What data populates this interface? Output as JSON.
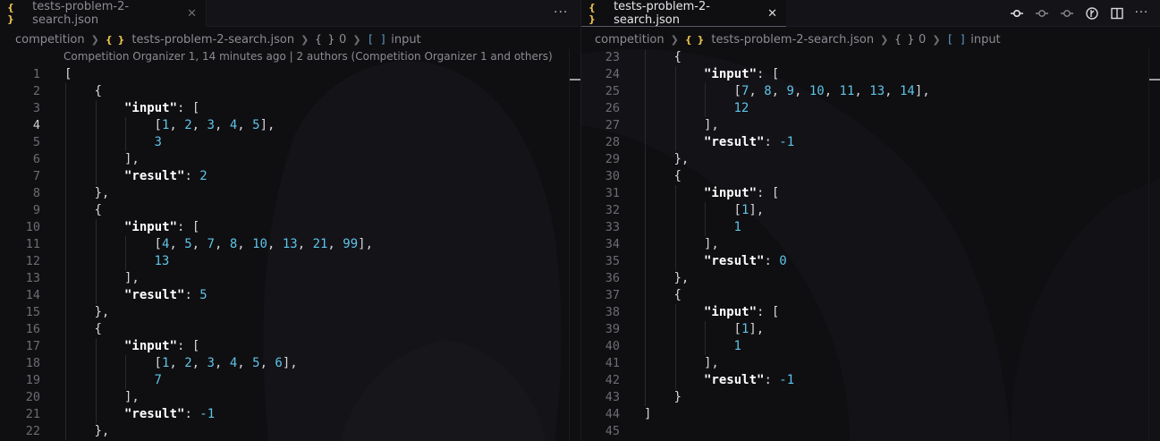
{
  "left_pane": {
    "tab": {
      "icon": "{ }",
      "label": "tests-problem-2-search.json",
      "close": "✕"
    },
    "more": "···",
    "breadcrumb": {
      "folder": "competition",
      "file_icon": "{ }",
      "file": "tests-problem-2-search.json",
      "obj_icon": "{ }",
      "obj": "0",
      "arr_icon": "[ ]",
      "field": "input"
    },
    "blame": "Competition Organizer 1, 14 minutes ago | 2 authors (Competition Organizer 1 and others)",
    "active_line": 4,
    "lines": [
      {
        "n": "1",
        "indent": 0,
        "t": [
          [
            "p",
            "["
          ]
        ]
      },
      {
        "n": "2",
        "indent": 1,
        "t": [
          [
            "p",
            "{"
          ]
        ]
      },
      {
        "n": "3",
        "indent": 2,
        "t": [
          [
            "k",
            "\"input\""
          ],
          [
            "p",
            ": ["
          ]
        ]
      },
      {
        "n": "4",
        "indent": 3,
        "t": [
          [
            "p",
            "["
          ],
          [
            "n",
            "1"
          ],
          [
            "p",
            ", "
          ],
          [
            "n",
            "2"
          ],
          [
            "p",
            ", "
          ],
          [
            "n",
            "3"
          ],
          [
            "p",
            ", "
          ],
          [
            "n",
            "4"
          ],
          [
            "p",
            ", "
          ],
          [
            "n",
            "5"
          ],
          [
            "p",
            "],"
          ]
        ]
      },
      {
        "n": "5",
        "indent": 3,
        "t": [
          [
            "n",
            "3"
          ]
        ]
      },
      {
        "n": "6",
        "indent": 2,
        "t": [
          [
            "p",
            "],"
          ]
        ]
      },
      {
        "n": "7",
        "indent": 2,
        "t": [
          [
            "k",
            "\"result\""
          ],
          [
            "p",
            ": "
          ],
          [
            "n",
            "2"
          ]
        ]
      },
      {
        "n": "8",
        "indent": 1,
        "t": [
          [
            "p",
            "},"
          ]
        ]
      },
      {
        "n": "9",
        "indent": 1,
        "t": [
          [
            "p",
            "{"
          ]
        ]
      },
      {
        "n": "10",
        "indent": 2,
        "t": [
          [
            "k",
            "\"input\""
          ],
          [
            "p",
            ": ["
          ]
        ]
      },
      {
        "n": "11",
        "indent": 3,
        "t": [
          [
            "p",
            "["
          ],
          [
            "n",
            "4"
          ],
          [
            "p",
            ", "
          ],
          [
            "n",
            "5"
          ],
          [
            "p",
            ", "
          ],
          [
            "n",
            "7"
          ],
          [
            "p",
            ", "
          ],
          [
            "n",
            "8"
          ],
          [
            "p",
            ", "
          ],
          [
            "n",
            "10"
          ],
          [
            "p",
            ", "
          ],
          [
            "n",
            "13"
          ],
          [
            "p",
            ", "
          ],
          [
            "n",
            "21"
          ],
          [
            "p",
            ", "
          ],
          [
            "n",
            "99"
          ],
          [
            "p",
            "],"
          ]
        ]
      },
      {
        "n": "12",
        "indent": 3,
        "t": [
          [
            "n",
            "13"
          ]
        ]
      },
      {
        "n": "13",
        "indent": 2,
        "t": [
          [
            "p",
            "],"
          ]
        ]
      },
      {
        "n": "14",
        "indent": 2,
        "t": [
          [
            "k",
            "\"result\""
          ],
          [
            "p",
            ": "
          ],
          [
            "n",
            "5"
          ]
        ]
      },
      {
        "n": "15",
        "indent": 1,
        "t": [
          [
            "p",
            "},"
          ]
        ]
      },
      {
        "n": "16",
        "indent": 1,
        "t": [
          [
            "p",
            "{"
          ]
        ]
      },
      {
        "n": "17",
        "indent": 2,
        "t": [
          [
            "k",
            "\"input\""
          ],
          [
            "p",
            ": ["
          ]
        ]
      },
      {
        "n": "18",
        "indent": 3,
        "t": [
          [
            "p",
            "["
          ],
          [
            "n",
            "1"
          ],
          [
            "p",
            ", "
          ],
          [
            "n",
            "2"
          ],
          [
            "p",
            ", "
          ],
          [
            "n",
            "3"
          ],
          [
            "p",
            ", "
          ],
          [
            "n",
            "4"
          ],
          [
            "p",
            ", "
          ],
          [
            "n",
            "5"
          ],
          [
            "p",
            ", "
          ],
          [
            "n",
            "6"
          ],
          [
            "p",
            "],"
          ]
        ]
      },
      {
        "n": "19",
        "indent": 3,
        "t": [
          [
            "n",
            "7"
          ]
        ]
      },
      {
        "n": "20",
        "indent": 2,
        "t": [
          [
            "p",
            "],"
          ]
        ]
      },
      {
        "n": "21",
        "indent": 2,
        "t": [
          [
            "k",
            "\"result\""
          ],
          [
            "p",
            ": "
          ],
          [
            "n",
            "-1"
          ]
        ]
      },
      {
        "n": "22",
        "indent": 1,
        "t": [
          [
            "p",
            "},"
          ]
        ]
      }
    ]
  },
  "right_pane": {
    "tab": {
      "icon": "{ }",
      "label": "tests-problem-2-search.json",
      "close": "✕"
    },
    "more": "···",
    "actions": [
      "git-compare-icon",
      "git-commit-prev-icon",
      "git-commit-next-icon",
      "timeline-icon",
      "split-editor-icon",
      "more-actions-icon"
    ],
    "breadcrumb": {
      "folder": "competition",
      "file_icon": "{ }",
      "file": "tests-problem-2-search.json",
      "obj_icon": "{ }",
      "obj": "0",
      "arr_icon": "[ ]",
      "field": "input"
    },
    "lines": [
      {
        "n": "23",
        "indent": 1,
        "t": [
          [
            "p",
            "{"
          ]
        ]
      },
      {
        "n": "24",
        "indent": 2,
        "t": [
          [
            "k",
            "\"input\""
          ],
          [
            "p",
            ": ["
          ]
        ]
      },
      {
        "n": "25",
        "indent": 3,
        "t": [
          [
            "p",
            "["
          ],
          [
            "n",
            "7"
          ],
          [
            "p",
            ", "
          ],
          [
            "n",
            "8"
          ],
          [
            "p",
            ", "
          ],
          [
            "n",
            "9"
          ],
          [
            "p",
            ", "
          ],
          [
            "n",
            "10"
          ],
          [
            "p",
            ", "
          ],
          [
            "n",
            "11"
          ],
          [
            "p",
            ", "
          ],
          [
            "n",
            "13"
          ],
          [
            "p",
            ", "
          ],
          [
            "n",
            "14"
          ],
          [
            "p",
            "],"
          ]
        ]
      },
      {
        "n": "26",
        "indent": 3,
        "t": [
          [
            "n",
            "12"
          ]
        ]
      },
      {
        "n": "27",
        "indent": 2,
        "t": [
          [
            "p",
            "],"
          ]
        ]
      },
      {
        "n": "28",
        "indent": 2,
        "t": [
          [
            "k",
            "\"result\""
          ],
          [
            "p",
            ": "
          ],
          [
            "n",
            "-1"
          ]
        ]
      },
      {
        "n": "29",
        "indent": 1,
        "t": [
          [
            "p",
            "},"
          ]
        ]
      },
      {
        "n": "30",
        "indent": 1,
        "t": [
          [
            "p",
            "{"
          ]
        ]
      },
      {
        "n": "31",
        "indent": 2,
        "t": [
          [
            "k",
            "\"input\""
          ],
          [
            "p",
            ": ["
          ]
        ]
      },
      {
        "n": "32",
        "indent": 3,
        "t": [
          [
            "p",
            "["
          ],
          [
            "n",
            "1"
          ],
          [
            "p",
            "],"
          ]
        ]
      },
      {
        "n": "33",
        "indent": 3,
        "t": [
          [
            "n",
            "1"
          ]
        ]
      },
      {
        "n": "34",
        "indent": 2,
        "t": [
          [
            "p",
            "],"
          ]
        ]
      },
      {
        "n": "35",
        "indent": 2,
        "t": [
          [
            "k",
            "\"result\""
          ],
          [
            "p",
            ": "
          ],
          [
            "n",
            "0"
          ]
        ]
      },
      {
        "n": "36",
        "indent": 1,
        "t": [
          [
            "p",
            "},"
          ]
        ]
      },
      {
        "n": "37",
        "indent": 1,
        "t": [
          [
            "p",
            "{"
          ]
        ]
      },
      {
        "n": "38",
        "indent": 2,
        "t": [
          [
            "k",
            "\"input\""
          ],
          [
            "p",
            ": ["
          ]
        ]
      },
      {
        "n": "39",
        "indent": 3,
        "t": [
          [
            "p",
            "["
          ],
          [
            "n",
            "1"
          ],
          [
            "p",
            "],"
          ]
        ]
      },
      {
        "n": "40",
        "indent": 3,
        "t": [
          [
            "n",
            "1"
          ]
        ]
      },
      {
        "n": "41",
        "indent": 2,
        "t": [
          [
            "p",
            "],"
          ]
        ]
      },
      {
        "n": "42",
        "indent": 2,
        "t": [
          [
            "k",
            "\"result\""
          ],
          [
            "p",
            ": "
          ],
          [
            "n",
            "-1"
          ]
        ]
      },
      {
        "n": "43",
        "indent": 1,
        "t": [
          [
            "p",
            "}"
          ]
        ]
      },
      {
        "n": "44",
        "indent": 0,
        "t": [
          [
            "p",
            "]"
          ]
        ]
      },
      {
        "n": "45",
        "indent": 0,
        "t": []
      }
    ]
  },
  "colors": {
    "background": "#0f0e11",
    "json_icon": "#e5c04d",
    "number": "#5ec4e8",
    "key": "#ffffff"
  }
}
